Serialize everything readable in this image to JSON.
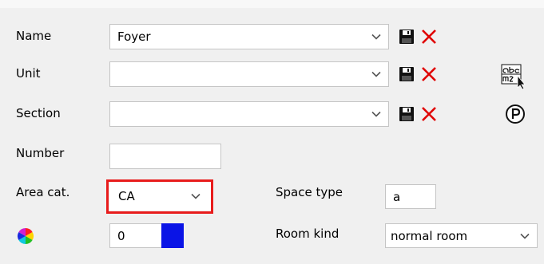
{
  "form": {
    "name": {
      "label": "Name",
      "value": "Foyer"
    },
    "unit": {
      "label": "Unit",
      "value": ""
    },
    "section": {
      "label": "Section",
      "value": ""
    },
    "number": {
      "label": "Number",
      "value": ""
    },
    "area_cat": {
      "label": "Area cat.",
      "value": "CA"
    },
    "color": {
      "value": "0",
      "swatch_color": "#0a14e6"
    },
    "space_type": {
      "label": "Space type",
      "value": "a"
    },
    "room_kind": {
      "label": "Room kind",
      "value": "normal room"
    }
  },
  "icons": {
    "save": "floppy-disk-icon",
    "delete": "red-x-icon",
    "text_area": "abc-m2-text-icon",
    "parking": "circled-p-icon",
    "color_wheel": "color-wheel-icon"
  },
  "colors": {
    "highlight": "#e81c1c",
    "delete_red": "#e00000"
  }
}
